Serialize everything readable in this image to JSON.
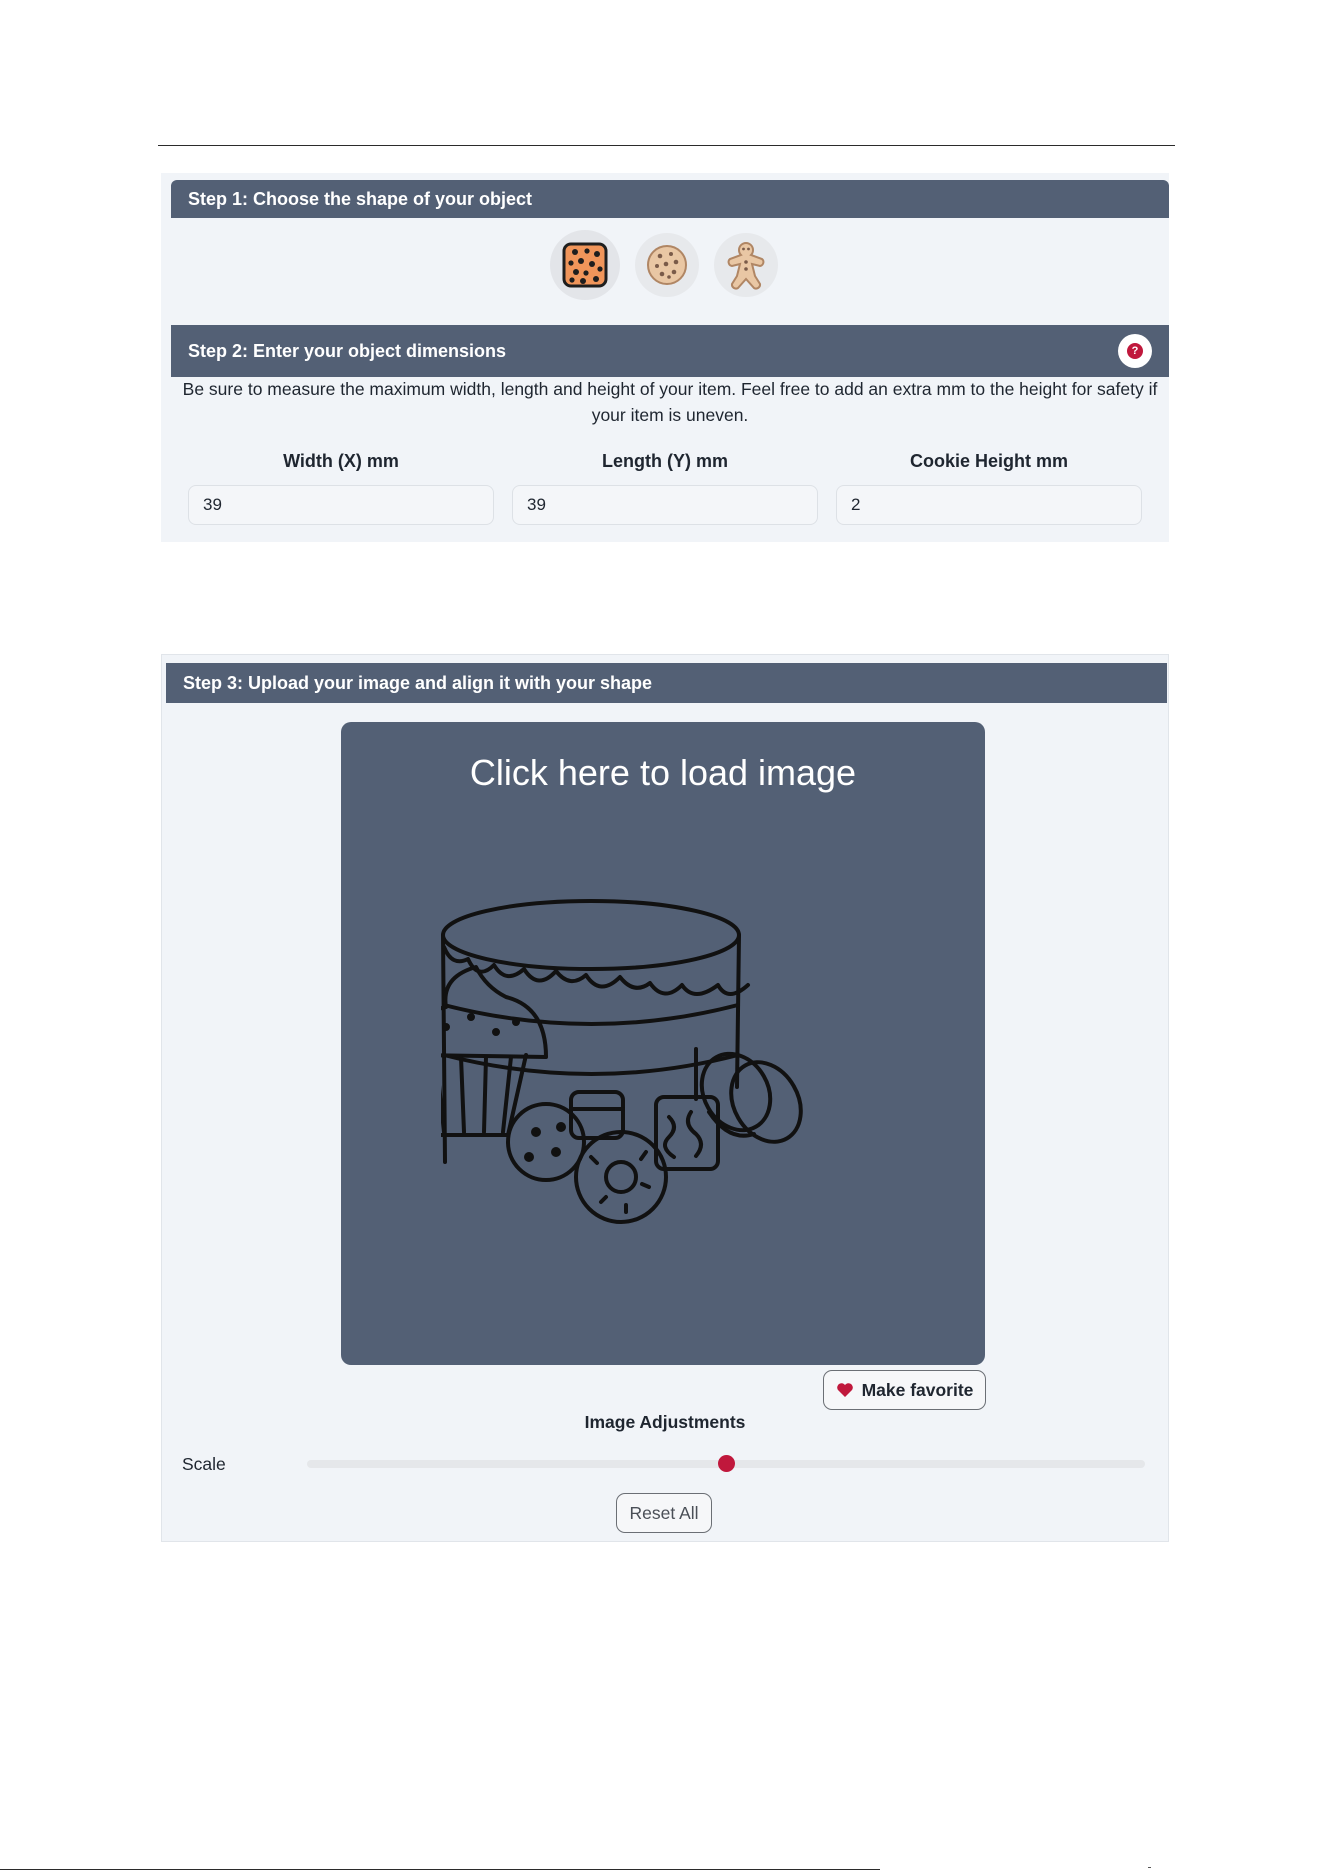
{
  "step1": {
    "title": "Step 1: Choose the shape of your object",
    "shapes": [
      {
        "name": "square cookie",
        "icon": "square-cookie-icon",
        "selected": true
      },
      {
        "name": "round cookie",
        "icon": "round-cookie-icon",
        "selected": false
      },
      {
        "name": "gingerbread man",
        "icon": "gingerbread-icon",
        "selected": false
      }
    ]
  },
  "step2": {
    "title": "Step 2: Enter your object dimensions",
    "help_glyph": "?",
    "instructions": "Be sure to measure the maximum width, length and height of your item. Feel free to add an extra mm to the height for safety if your item is uneven.",
    "width_label": "Width (X) mm",
    "width_value": "39",
    "length_label": "Length (Y) mm",
    "length_value": "39",
    "height_label": "Cookie Height mm",
    "height_value": "2"
  },
  "step3": {
    "title": "Step 3: Upload your image and align it with your shape",
    "upload_prompt": "Click here to load image",
    "favorite_label": "Make favorite",
    "adjustments_title": "Image Adjustments",
    "scale_label": "Scale",
    "scale_value_fraction": 0.5,
    "reset_label": "Reset All"
  },
  "colors": {
    "header": "#536075",
    "accent": "#c0183c",
    "panel": "#f1f4f8"
  }
}
